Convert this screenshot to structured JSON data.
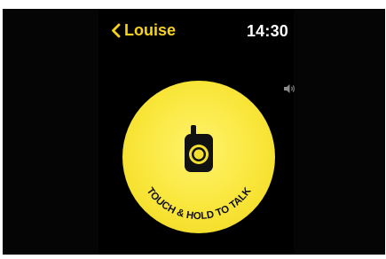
{
  "header": {
    "back_label": "Louise",
    "time": "14:30"
  },
  "talk_button": {
    "label": "TOUCH & HOLD TO TALK"
  },
  "icons": {
    "back": "chevron-left-icon",
    "volume": "speaker-volume-icon",
    "walkie_talkie": "walkie-talkie-icon"
  },
  "colors": {
    "accent": "#f6d21a",
    "button_yellow": "#f9e63a",
    "background": "#000000"
  }
}
